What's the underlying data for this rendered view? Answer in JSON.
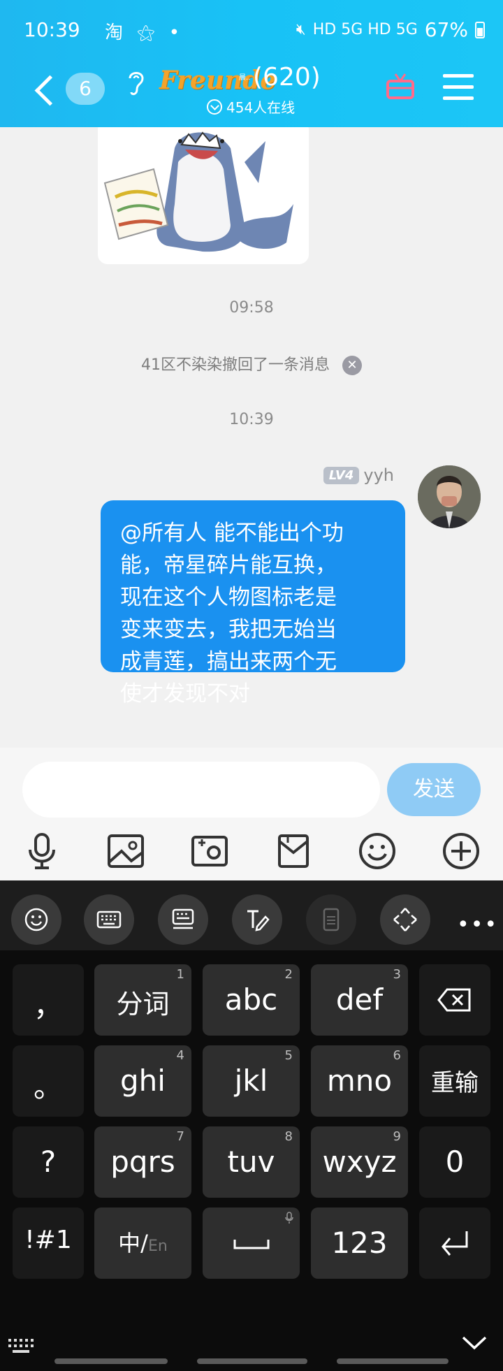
{
  "status_bar": {
    "time": "10:39",
    "left_icons": "淘 ⚝ •",
    "network": "HD 5G HD 5G",
    "battery": "67%"
  },
  "header": {
    "unread_count": "6",
    "group_logo": "Freunde",
    "group_logo_sub": "晨..",
    "group_count": "(620)",
    "online": "454人在线"
  },
  "chat": {
    "timestamps": [
      "09:58",
      "10:39"
    ],
    "recall_notice": "41区不染染撤回了一条消息",
    "message": {
      "level": "LV4",
      "sender": "yyh",
      "lines": [
        "@所有人 能不能出个功",
        "能，帝星碎片能互换，",
        "现在这个人物图标老是",
        "变来变去，我把无始当",
        "成青莲，搞出来两个无",
        "使才发现不对"
      ]
    }
  },
  "input": {
    "value": "",
    "send_label": "发送"
  },
  "toolbar": {
    "items": [
      "mic-icon",
      "image-icon",
      "camera-icon",
      "file-icon",
      "emoji-icon",
      "plus-icon"
    ]
  },
  "keyboard": {
    "more": "•••",
    "keys": {
      "comma": "，",
      "fenci": "分词",
      "fenci_num": "1",
      "abc": "abc",
      "abc_num": "2",
      "def": "def",
      "def_num": "3",
      "period": "。",
      "ghi": "ghi",
      "ghi_num": "4",
      "jkl": "jkl",
      "jkl_num": "5",
      "mno": "mno",
      "mno_num": "6",
      "reinput": "重输",
      "question": "?",
      "pqrs": "pqrs",
      "pqrs_num": "7",
      "tuv": "tuv",
      "tuv_num": "8",
      "wxyz": "wxyz",
      "wxyz_num": "9",
      "zero": "0",
      "symbols": "!#1",
      "zh": "中/",
      "en": "En",
      "num123": "123"
    }
  },
  "colors": {
    "header_bg": "#18c2f6",
    "bubble": "#1a91f0",
    "send_button": "#8fcbf5",
    "keyboard_bg": "#0c0c0c"
  }
}
